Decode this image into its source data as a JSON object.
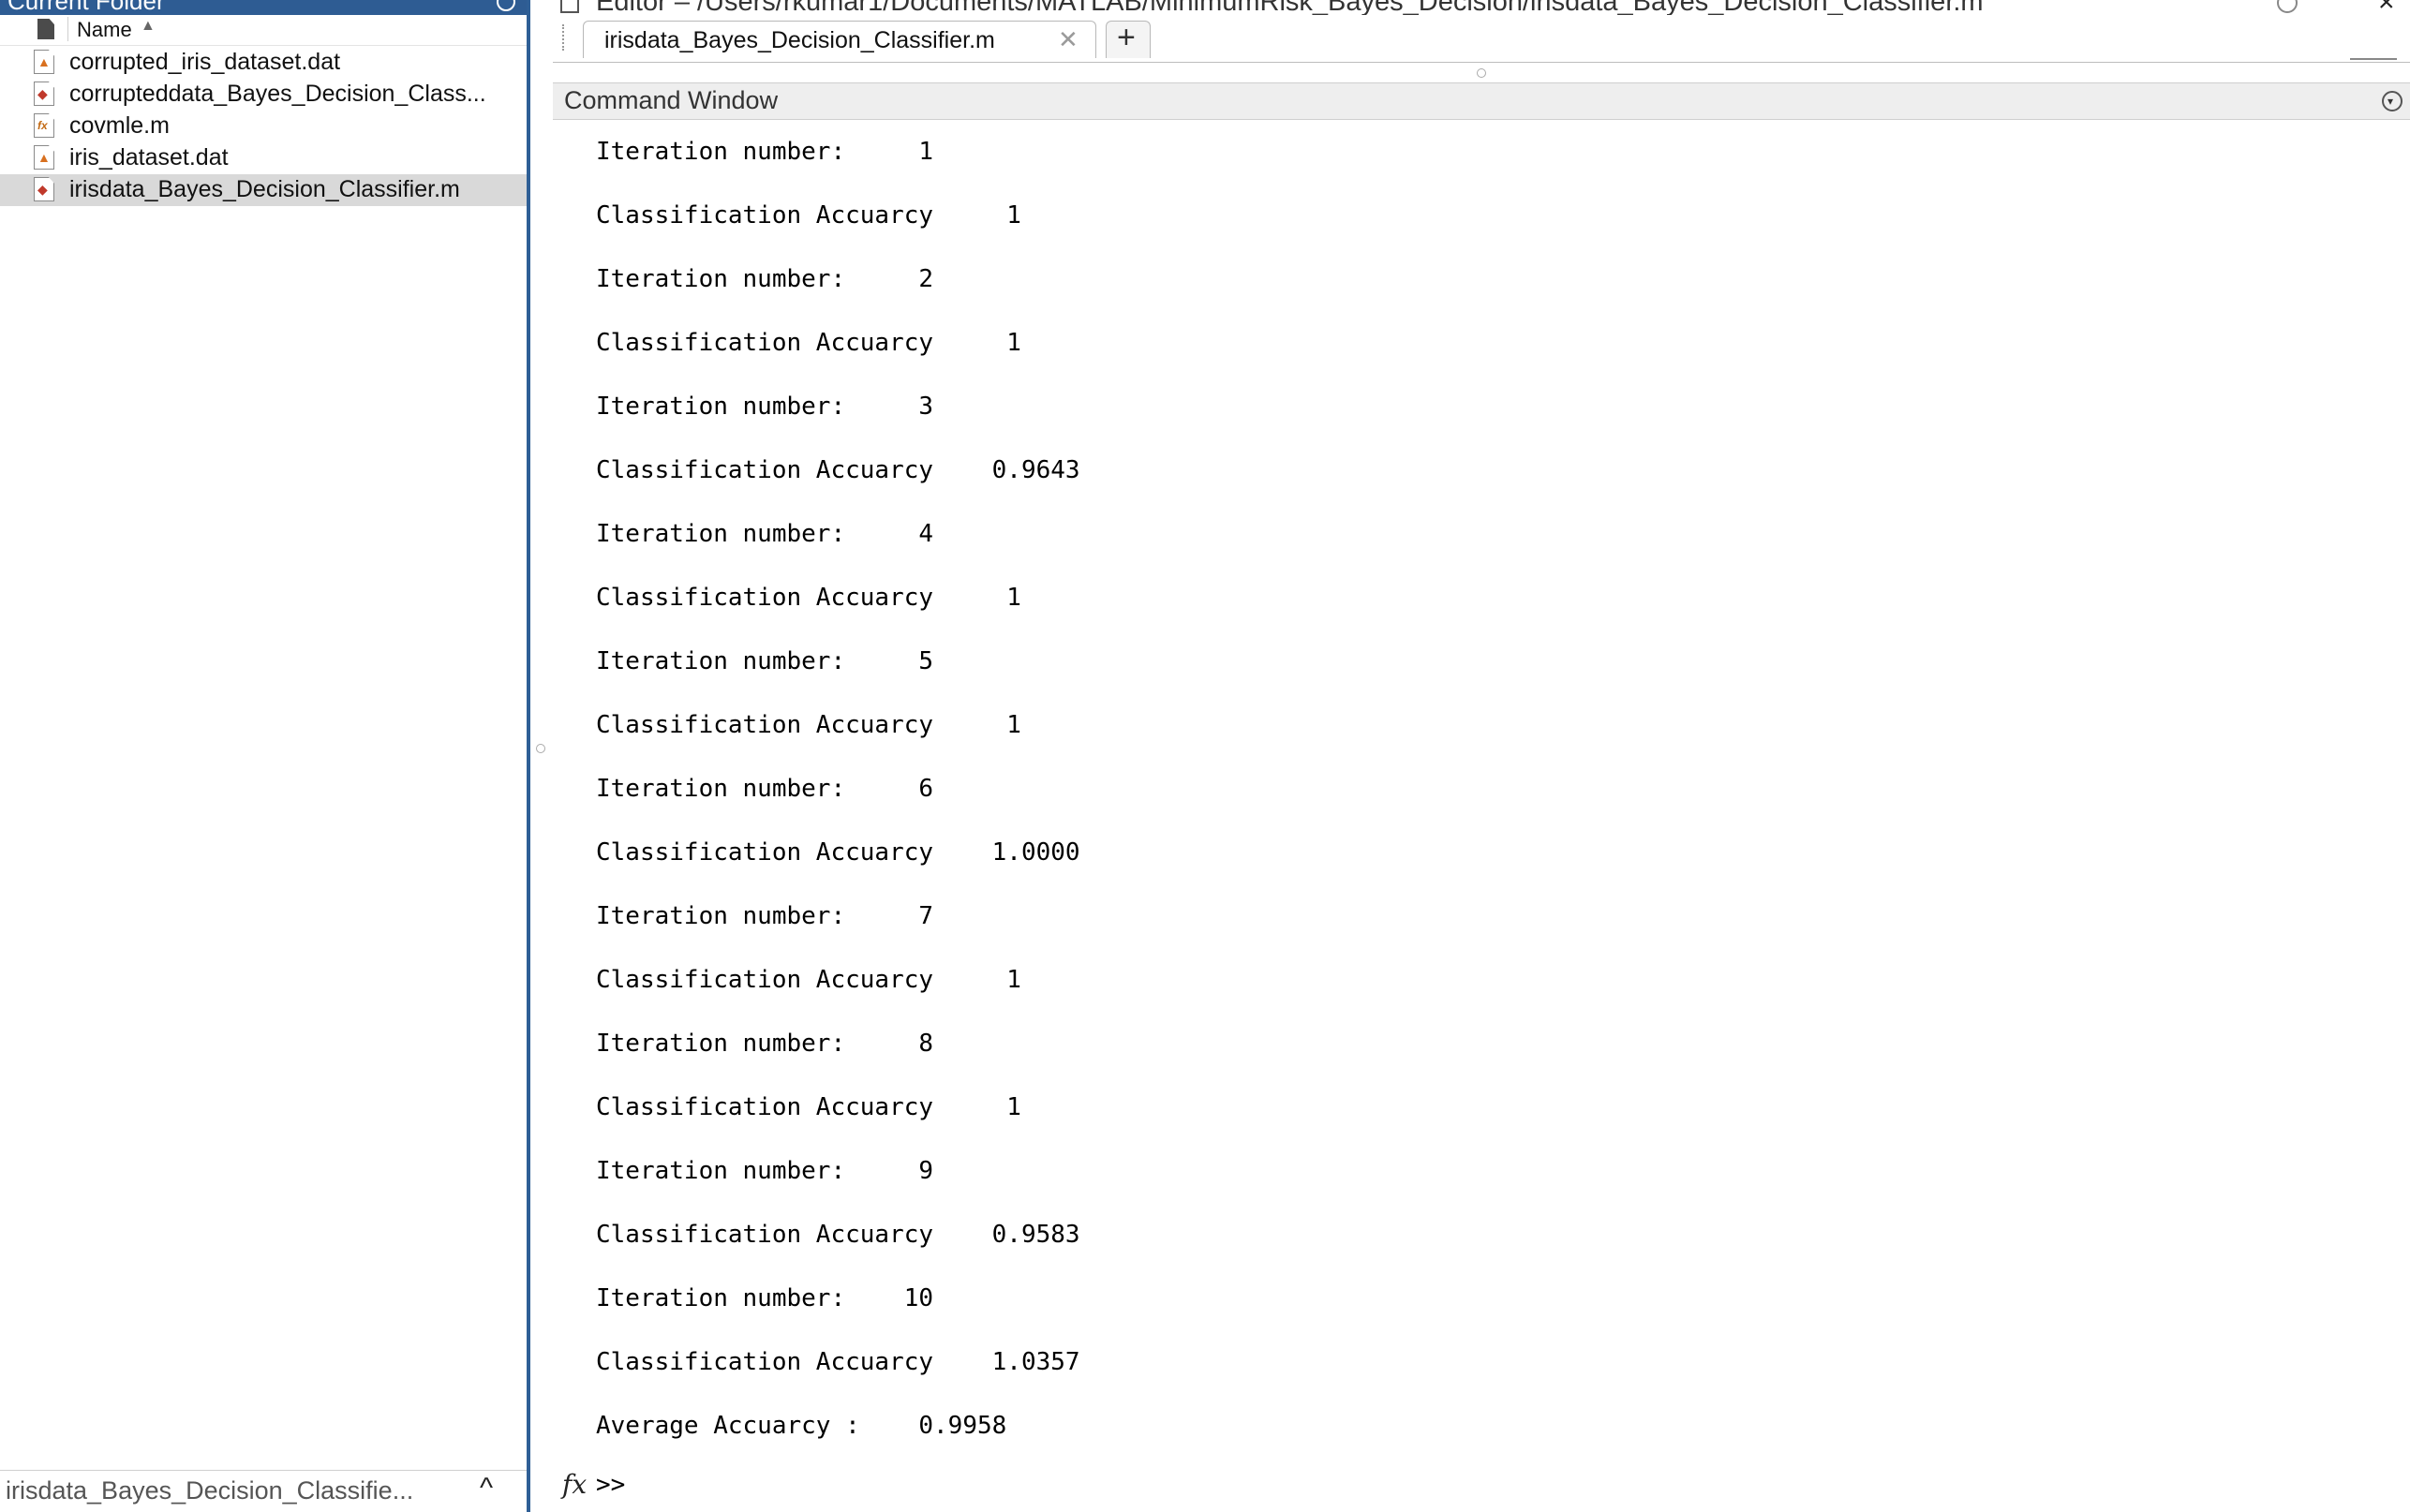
{
  "current_folder": {
    "title": "Current Folder",
    "column_header": "Name",
    "sort_indicator": "▲",
    "files": [
      {
        "name": "corrupted_iris_dataset.dat",
        "type": "dat",
        "selected": false
      },
      {
        "name": "corrupteddata_Bayes_Decision_Class...",
        "type": "mscript",
        "selected": false
      },
      {
        "name": "covmle.m",
        "type": "mfunc",
        "selected": false
      },
      {
        "name": "iris_dataset.dat",
        "type": "dat",
        "selected": false
      },
      {
        "name": "irisdata_Bayes_Decision_Classifier.m",
        "type": "mscript",
        "selected": true
      }
    ],
    "footer_label": "irisdata_Bayes_Decision_Classifie...",
    "footer_chevron": "^"
  },
  "editor": {
    "title": "Editor – /Users/rkumar1/Documents/MATLAB/MinimumRisk_Bayes_Decision/irisdata_Bayes_Decision_Classifier.m",
    "close_glyph": "×",
    "tab_label": "irisdata_Bayes_Decision_Classifier.m",
    "tab_close_glyph": "✕",
    "new_tab_glyph": "+"
  },
  "command_window": {
    "title": "Command Window",
    "menu_glyph": "▾",
    "output": [
      "Iteration number:     1",
      "Classification Accuarcy     1",
      "Iteration number:     2",
      "Classification Accuarcy     1",
      "Iteration number:     3",
      "Classification Accuarcy    0.9643",
      "Iteration number:     4",
      "Classification Accuarcy     1",
      "Iteration number:     5",
      "Classification Accuarcy     1",
      "Iteration number:     6",
      "Classification Accuarcy    1.0000",
      "Iteration number:     7",
      "Classification Accuarcy     1",
      "Iteration number:     8",
      "Classification Accuarcy     1",
      "Iteration number:     9",
      "Classification Accuarcy    0.9583",
      "Iteration number:    10",
      "Classification Accuarcy    1.0357",
      "Average Accuarcy :    0.9958"
    ],
    "fx_glyph": "fx",
    "prompt": ">>"
  }
}
